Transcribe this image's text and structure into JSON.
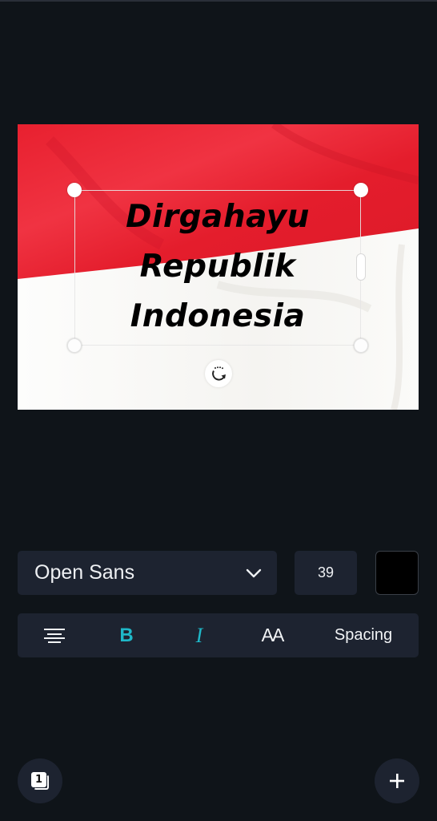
{
  "canvas": {
    "headline_lines": [
      "Dirgahayu",
      "Republik",
      "Indonesia"
    ],
    "flag_colors": {
      "red": "#e8202f",
      "white": "#fbfbf9"
    },
    "text_color": "#000000"
  },
  "toolbar": {
    "font_family": "Open Sans",
    "font_size": "39",
    "text_color_swatch": "#000000"
  },
  "format_bar": {
    "align_icon": "align-center-icon",
    "bold_label": "B",
    "italic_label": "I",
    "case_label": "AA",
    "spacing_label": "Spacing",
    "active_color": "#1fb8c8"
  },
  "bottom": {
    "page_count": "1",
    "add_icon": "plus-icon"
  }
}
